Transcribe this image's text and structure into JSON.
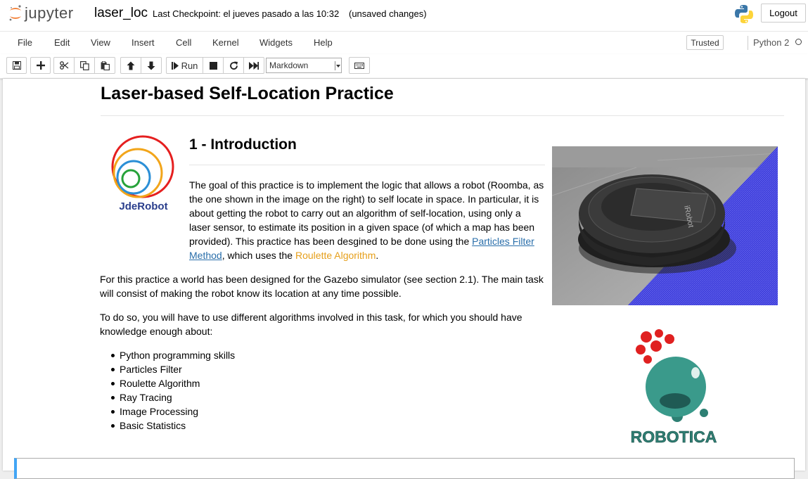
{
  "header": {
    "logo_text": "jupyter",
    "notebook_name": "laser_loc",
    "checkpoint": "Last Checkpoint: el jueves pasado a las 10:32",
    "unsaved": "(unsaved changes)",
    "logout_label": "Logout"
  },
  "menubar": {
    "items": [
      "File",
      "Edit",
      "View",
      "Insert",
      "Cell",
      "Kernel",
      "Widgets",
      "Help"
    ],
    "trusted_label": "Trusted",
    "kernel_name": "Python 2"
  },
  "toolbar": {
    "run_label": "Run",
    "cell_type": "Markdown",
    "icons": [
      "save-icon",
      "plus-icon",
      "cut-icon",
      "copy-icon",
      "paste-icon",
      "arrow-up-icon",
      "arrow-down-icon",
      "step-forward-icon",
      "stop-icon",
      "restart-icon",
      "fast-forward-icon",
      "keyboard-icon"
    ]
  },
  "content": {
    "title": "Laser-based Self-Location Practice",
    "section_heading": "1 - Introduction",
    "intro_text_1": "The goal of this practice is to implement the logic that allows a robot (Roomba, as the one shown in the image on the right) to self locate in space. In particular, it is about getting the robot to carry out an algorithm of self-location, using only a laser sensor, to estimate its position in a given space (of which a map has been provided). This practice has been desgined to be done using the ",
    "link_text": "Particles Filter Method",
    "intro_text_2": ", which uses the ",
    "highlight_text": "Roulette Algorithm",
    "intro_text_3": ".",
    "para2": "For this practice a world has been designed for the Gazebo simulator (see section 2.1). The main task will consist of making the robot know its location at any time possible.",
    "para3": "To do so, you will have to use different algorithms involved in this task, for which you should have knowledge enough about:",
    "skills": [
      "Python programming skills",
      "Particles Filter",
      "Roulette Algorithm",
      "Ray Tracing",
      "Image Processing",
      "Basic Statistics"
    ],
    "jderobot_logo_text": "JdeRobot",
    "robotica_logo_text": "ROBOTICA",
    "roomba_label": "iRobot"
  },
  "colors": {
    "link": "#296eaa",
    "highlight": "#e69f1a",
    "active_cell": "#42a5f5"
  }
}
